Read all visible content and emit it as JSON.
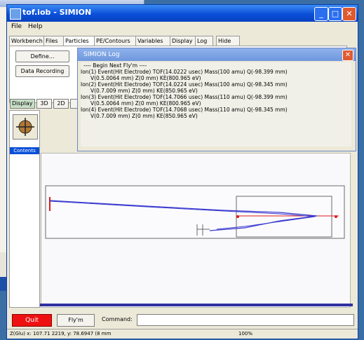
{
  "background_window": {},
  "window": {
    "title": "tof.iob - SIMION",
    "controls": {
      "minimize": "_",
      "maximize": "□",
      "close": "✕"
    }
  },
  "menu": {
    "file": "File",
    "help": "Help"
  },
  "tabs": [
    "Workbench",
    "Files",
    "Particles",
    "PE/Contours",
    "Variables",
    "Display",
    "Log",
    "Hide"
  ],
  "particles_panel": {
    "define_button": "Define...",
    "data_recording_button": "Data Recording"
  },
  "display_bar": {
    "label": "Display",
    "btn_3d": "3D",
    "btn_2d": "2D"
  },
  "left_panel": {
    "thumbnail_label": "Contents"
  },
  "log_window": {
    "title": "SIMION Log",
    "lines": [
      "---- Begin Next Fly'm ----",
      "Ion(1) Event(Hit Electrode) TOF(14.0222 usec) Mass(100 amu) Q(-98.399 mm)",
      "V(0.5.0064 mm) Z(0 mm) KE(800.965 eV)",
      "Ion(2) Event(Hit Electrode) TOF(14.0224 usec) Mass(100 amu) Q(-98.345 mm)",
      "V(0.7.009 mm) Z(0 mm) KE(850.965 eV)",
      "Ion(3) Event(Hit Electrode) TOF(14.7066 usec) Mass(110 amu) Q(-98.399 mm)",
      "V(0.5.0064 mm) Z(0 mm) KE(800.965 eV)",
      "Ion(4) Event(Hit Electrode) TOF(14.7068 usec) Mass(110 amu) Q(-98.345 mm)",
      "V(0.7.009 mm) Z(0 mm) KE(850.965 eV)"
    ]
  },
  "bottom": {
    "quit": "Quit",
    "fly_button": "Fly'm",
    "command_label": "Command:",
    "command_value": ""
  },
  "status": {
    "coords": "Z(Glu) x: 107.71 2219, y: 78.6947 (8 mm",
    "zoom": "100%"
  },
  "colors": {
    "title_bar": "#0a4fd8",
    "quit_button": "#ee1111",
    "trajectory_blue": "#3a3ad0",
    "trajectory_red": "#e01a1a",
    "electrode_gray": "#6a6a6a"
  }
}
